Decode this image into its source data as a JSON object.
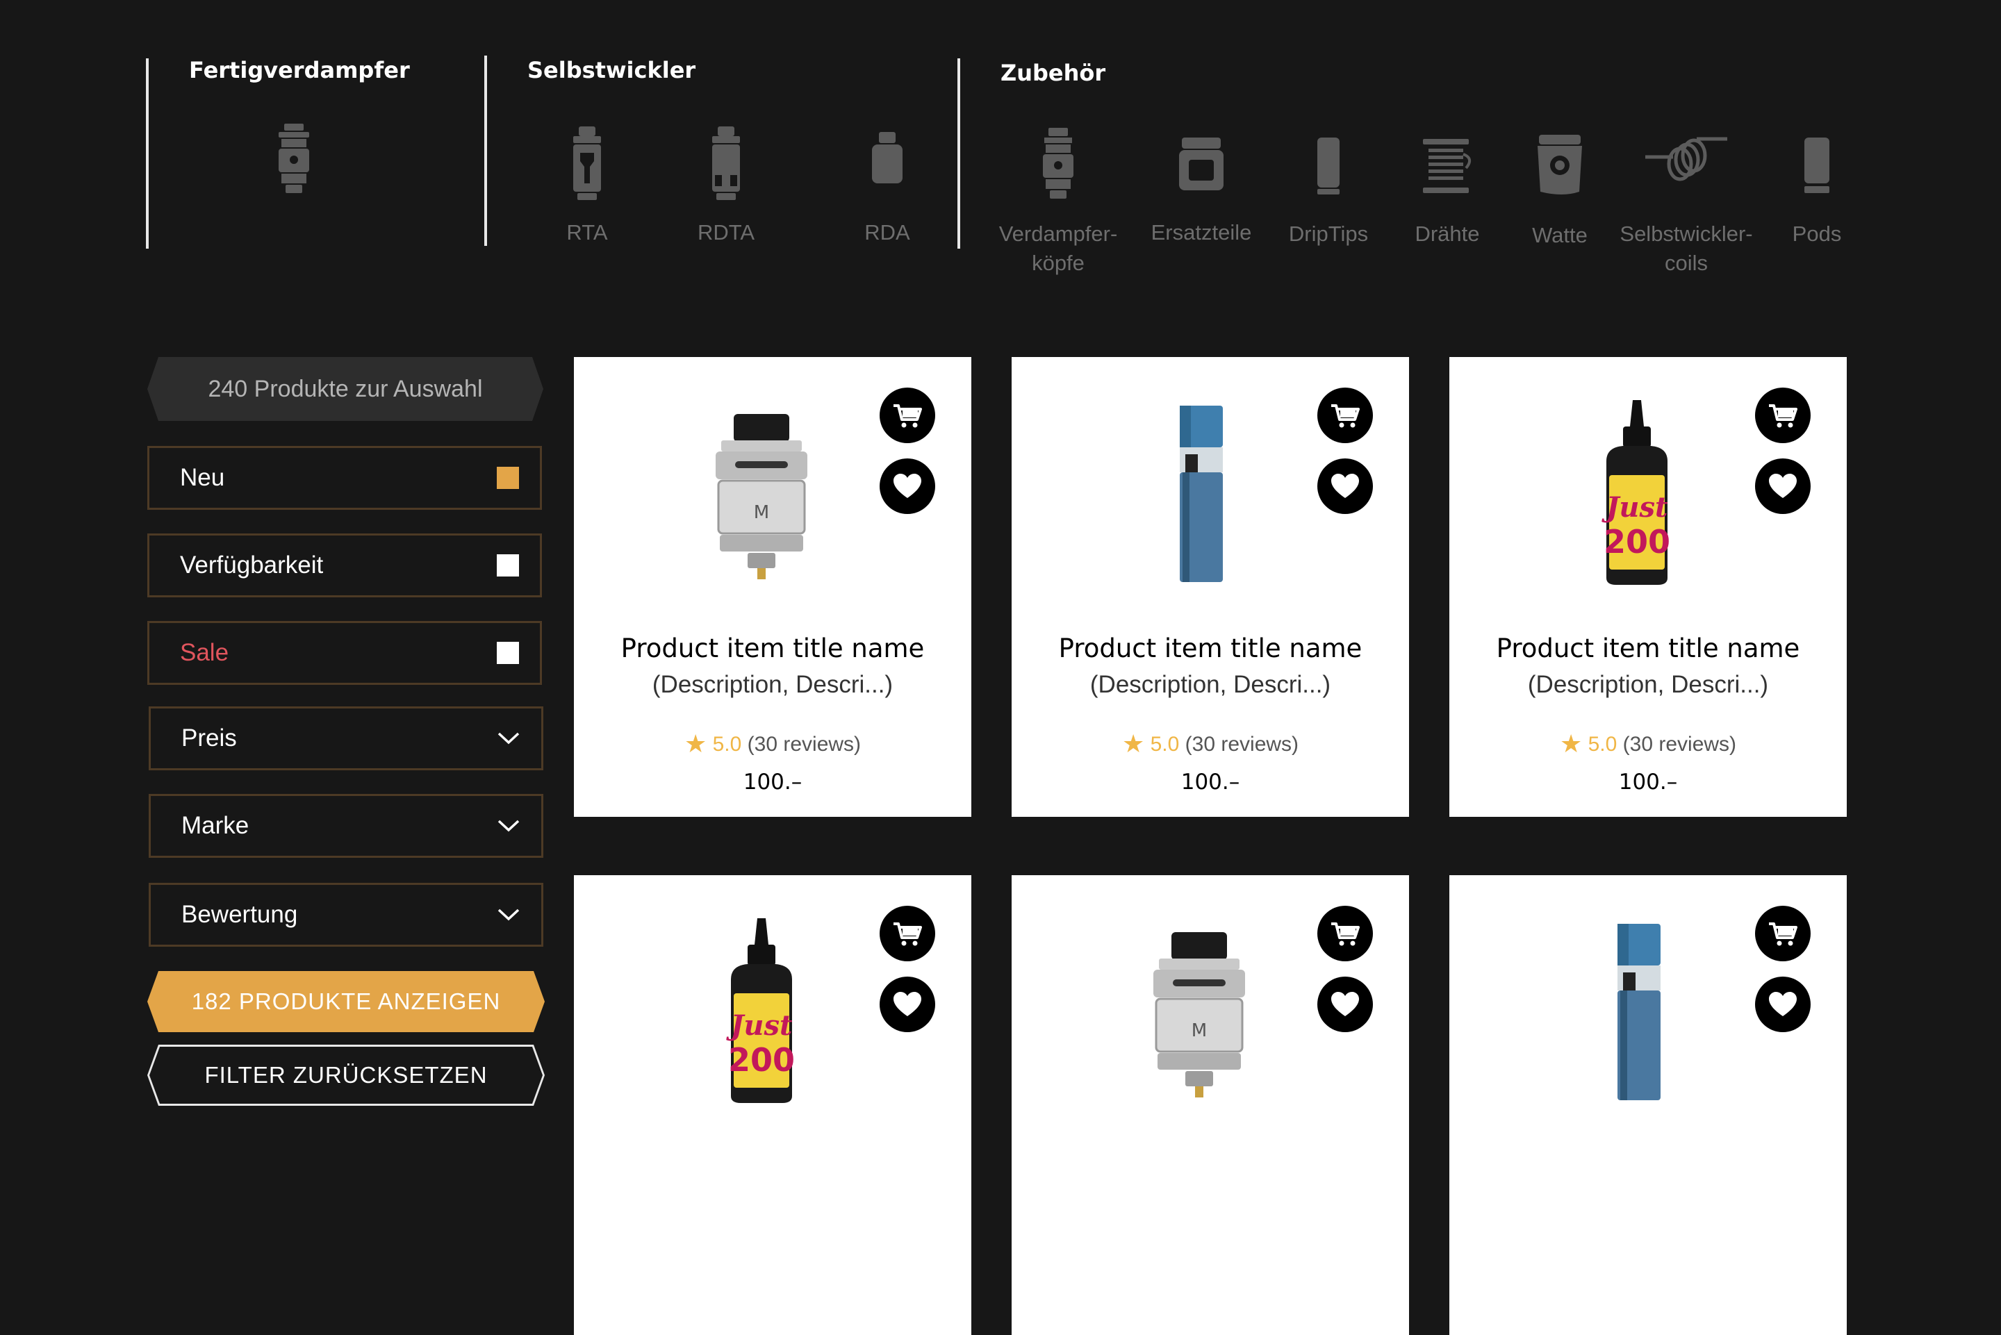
{
  "nav": {
    "groups": [
      {
        "title": "Fertigverdampfer"
      },
      {
        "title": "Selbstwickler"
      },
      {
        "title": "Zubehör"
      }
    ],
    "categories": [
      {
        "label": "",
        "icon": "atomizer-icon"
      },
      {
        "label": "RTA",
        "icon": "rta-tank-icon"
      },
      {
        "label": "RDTA",
        "icon": "rdta-tank-icon"
      },
      {
        "label": "RDA",
        "icon": "rda-dripper-icon"
      },
      {
        "label": "Verdampfer-köpfe",
        "icon": "coil-head-icon"
      },
      {
        "label": "Ersatzteile",
        "icon": "glass-tank-icon"
      },
      {
        "label": "DripTips",
        "icon": "drip-tip-icon"
      },
      {
        "label": "Drähte",
        "icon": "wire-spool-icon"
      },
      {
        "label": "Watte",
        "icon": "cotton-icon"
      },
      {
        "label": "Selbstwickler-coils",
        "icon": "coils-icon"
      },
      {
        "label": "Pods",
        "icon": "pod-icon"
      }
    ]
  },
  "sidebar": {
    "count_label": "240 Produkte zur Auswahl",
    "filters": [
      {
        "label": "Neu",
        "type": "checkbox",
        "checked": true
      },
      {
        "label": "Verfügbarkeit",
        "type": "checkbox",
        "checked": false
      },
      {
        "label": "Sale",
        "type": "checkbox",
        "checked": false
      },
      {
        "label": "Preis",
        "type": "dropdown"
      },
      {
        "label": "Marke",
        "type": "dropdown"
      },
      {
        "label": "Bewertung",
        "type": "dropdown"
      }
    ],
    "show_button": "182 PRODUKTE ANZEIGEN",
    "reset_button": "FILTER ZURÜCKSETZEN"
  },
  "products": [
    {
      "title": "Product item title name",
      "desc": "(Description, Descri...)",
      "score": "5.0",
      "reviews": "(30 reviews)",
      "price": "100.–",
      "image": "tank"
    },
    {
      "title": "Product item title name",
      "desc": "(Description, Descri...)",
      "score": "5.0",
      "reviews": "(30 reviews)",
      "price": "100.–",
      "image": "pod"
    },
    {
      "title": "Product item title name",
      "desc": "(Description, Descri...)",
      "score": "5.0",
      "reviews": "(30 reviews)",
      "price": "100.–",
      "image": "bottle"
    },
    {
      "title": "",
      "desc": "",
      "score": "",
      "reviews": "",
      "price": "",
      "image": "bottle"
    },
    {
      "title": "",
      "desc": "",
      "score": "",
      "reviews": "",
      "price": "",
      "image": "tank"
    },
    {
      "title": "",
      "desc": "",
      "score": "",
      "reviews": "",
      "price": "",
      "image": "pod"
    }
  ],
  "colors": {
    "accent": "#e3a548",
    "sale": "#e0555d",
    "background": "#171717",
    "filter_border": "#4d3a25",
    "star": "#f0b646"
  }
}
